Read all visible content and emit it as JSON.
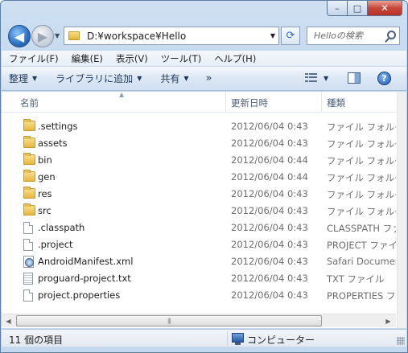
{
  "window": {
    "caption_buttons": {
      "minimize": "–",
      "maximize": "□",
      "close": "✕"
    }
  },
  "nav": {
    "back_glyph": "◀",
    "forward_glyph": "▶",
    "history_glyph": "▼"
  },
  "address": {
    "path": "D:¥workspace¥Hello",
    "dropdown_glyph": "▼",
    "refresh_glyph": "⟳"
  },
  "search": {
    "placeholder": "Helloの検索"
  },
  "menu": {
    "items": [
      "ファイル(F)",
      "編集(E)",
      "表示(V)",
      "ツール(T)",
      "ヘルプ(H)"
    ]
  },
  "toolbar": {
    "organize": "整理",
    "library": "ライブラリに追加",
    "share": "共有",
    "more": "»",
    "dropdown_glyph": "▼",
    "help_glyph": "?"
  },
  "columns": {
    "name": "名前",
    "date": "更新日時",
    "type": "種類",
    "sort_glyph": "▲"
  },
  "files": [
    {
      "name": ".settings",
      "date": "2012/06/04 0:43",
      "type": "ファイル フォルダー",
      "icon": "folder-icon"
    },
    {
      "name": "assets",
      "date": "2012/06/04 0:43",
      "type": "ファイル フォルダー",
      "icon": "folder-icon"
    },
    {
      "name": "bin",
      "date": "2012/06/04 0:44",
      "type": "ファイル フォルダー",
      "icon": "folder-icon"
    },
    {
      "name": "gen",
      "date": "2012/06/04 0:44",
      "type": "ファイル フォルダー",
      "icon": "folder-icon"
    },
    {
      "name": "res",
      "date": "2012/06/04 0:43",
      "type": "ファイル フォルダー",
      "icon": "folder-icon"
    },
    {
      "name": "src",
      "date": "2012/06/04 0:43",
      "type": "ファイル フォルダー",
      "icon": "folder-icon"
    },
    {
      "name": ".classpath",
      "date": "2012/06/04 0:43",
      "type": "CLASSPATH ファイル",
      "icon": "file-icon"
    },
    {
      "name": ".project",
      "date": "2012/06/04 0:43",
      "type": "PROJECT ファイル",
      "icon": "file-icon"
    },
    {
      "name": "AndroidManifest.xml",
      "date": "2012/06/04 0:43",
      "type": "Safari Document",
      "icon": "safari-document-icon"
    },
    {
      "name": "proguard-project.txt",
      "date": "2012/06/04 0:43",
      "type": "TXT ファイル",
      "icon": "text-file-icon"
    },
    {
      "name": "project.properties",
      "date": "2012/06/04 0:43",
      "type": "PROPERTIES ファイル",
      "icon": "file-icon"
    }
  ],
  "scrollbar": {
    "left_glyph": "◀",
    "right_glyph": "▶",
    "grip": "|||"
  },
  "status": {
    "count": "11 個の項目",
    "location": "コンピューター"
  }
}
